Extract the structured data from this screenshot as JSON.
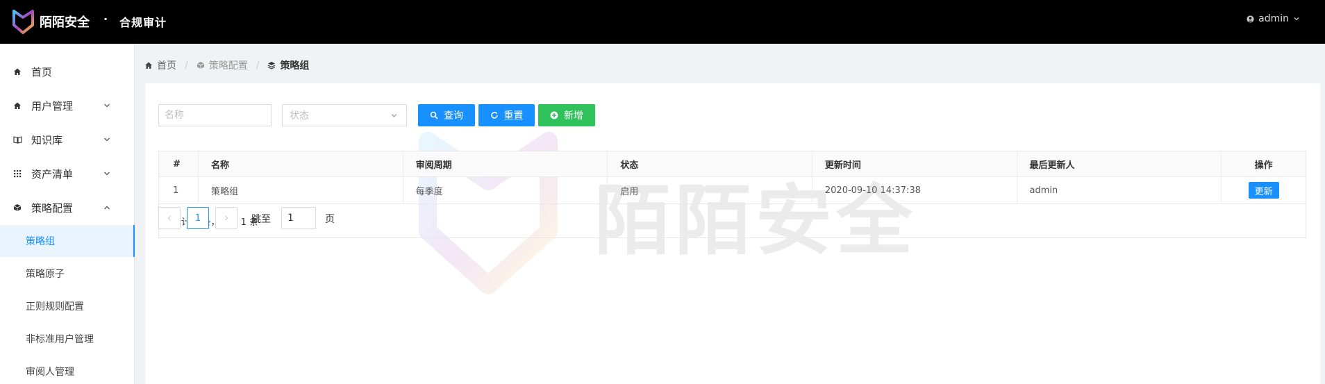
{
  "header": {
    "brand": "陌陌安全",
    "separator": "·",
    "subtitle": "合规审计",
    "user": "admin"
  },
  "sidebar": {
    "items": [
      {
        "label": "首页",
        "icon": "home-icon"
      },
      {
        "label": "用户管理",
        "icon": "home-icon"
      },
      {
        "label": "知识库",
        "icon": "book-icon"
      },
      {
        "label": "资产清单",
        "icon": "grid-icon"
      },
      {
        "label": "策略配置",
        "icon": "cube-icon"
      }
    ],
    "subitems": [
      {
        "label": "策略组"
      },
      {
        "label": "策略原子"
      },
      {
        "label": "正则规则配置"
      },
      {
        "label": "非标准用户管理"
      },
      {
        "label": "审阅人管理"
      }
    ]
  },
  "breadcrumb": {
    "home": "首页",
    "config": "策略配置",
    "current": "策略组"
  },
  "filters": {
    "name_placeholder": "名称",
    "status_placeholder": "状态",
    "search_label": "查询",
    "reset_label": "重置",
    "add_label": "新增"
  },
  "table": {
    "headers": [
      "#",
      "名称",
      "审阅周期",
      "状态",
      "更新时间",
      "最后更新人",
      "操作"
    ],
    "rows": [
      {
        "index": "1",
        "name": "策略组",
        "cycle": "每季度",
        "status": "启用",
        "updated": "2020-09-10 14:37:38",
        "updater": "admin",
        "action": "更新"
      }
    ],
    "footer": "总计 1 条，本页 1 条"
  },
  "pagination": {
    "current": "1",
    "jump_label": "跳至",
    "jump_value": "1",
    "page_suffix": "页"
  },
  "watermark": {
    "text": "陌陌安全"
  },
  "colors": {
    "primary": "#1890ff",
    "success": "#2fc25b",
    "header_bg": "#000000"
  }
}
